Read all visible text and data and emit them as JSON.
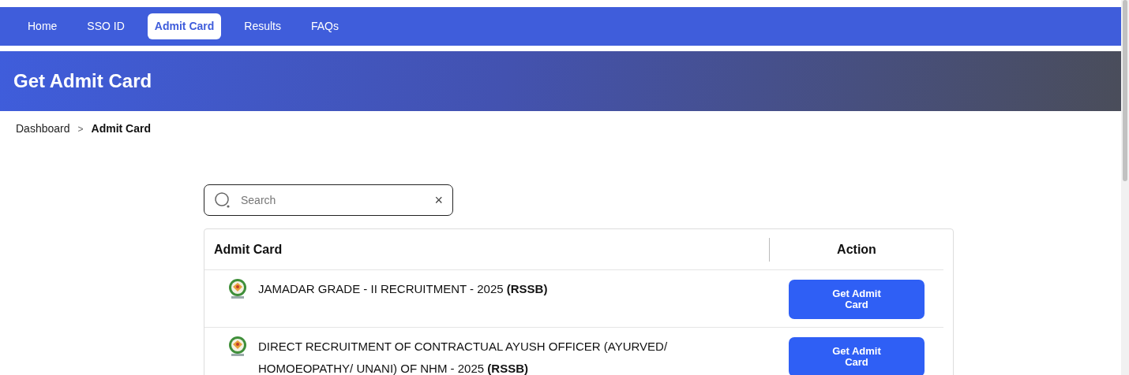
{
  "nav": [
    {
      "label": "Home",
      "selected": false
    },
    {
      "label": "SSO ID",
      "selected": false
    },
    {
      "label": "Admit Card",
      "selected": true
    },
    {
      "label": "Results",
      "selected": false
    },
    {
      "label": "FAQs",
      "selected": false
    }
  ],
  "banner": {
    "title": "Get Admit Card"
  },
  "breadcrumb": {
    "items": [
      "Dashboard"
    ],
    "separator": ">",
    "current": "Admit Card"
  },
  "search": {
    "placeholder": "Search",
    "clear": "×"
  },
  "table": {
    "columns": [
      "Admit Card",
      "Action"
    ],
    "rows": [
      {
        "title": "JAMADAR GRADE - II RECRUITMENT - 2025 **(RSSB)**",
        "action": "Get Admit Card"
      },
      {
        "title": "DIRECT RECRUITMENT OF CONTRACTUAL AYUSH OFFICER (AYURVED/ HOMOEOPATHY/ UNANI) OF NHM - 2025 **(RSSB)**",
        "action": "Get Admit Card"
      }
    ]
  }
}
